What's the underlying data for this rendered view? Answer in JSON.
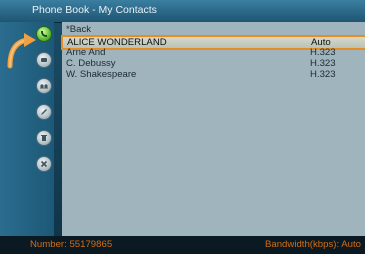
{
  "window": {
    "title": "Phone Book - My Contacts"
  },
  "list": {
    "back_label": "*Back",
    "rows": [
      {
        "name": "ALICE WONDERLAND",
        "protocol": "Auto"
      },
      {
        "name": "Arne And",
        "protocol": "H.323"
      },
      {
        "name": "C. Debussy",
        "protocol": "H.323"
      },
      {
        "name": "W. Shakespeare",
        "protocol": "H.323"
      }
    ]
  },
  "side_icons": [
    {
      "icon": "call-icon"
    },
    {
      "icon": "phonebook-icon"
    },
    {
      "icon": "tape-icon"
    },
    {
      "icon": "pencil-icon"
    },
    {
      "icon": "delete-icon"
    },
    {
      "icon": "close-icon"
    }
  ],
  "status": {
    "number_label": "Number:",
    "number_value": "55179865",
    "bandwidth_label": "Bandwidth(kbps):",
    "bandwidth_value": "Auto"
  },
  "colors": {
    "highlight_border": "#e58d25",
    "status_text": "#d46c12"
  }
}
